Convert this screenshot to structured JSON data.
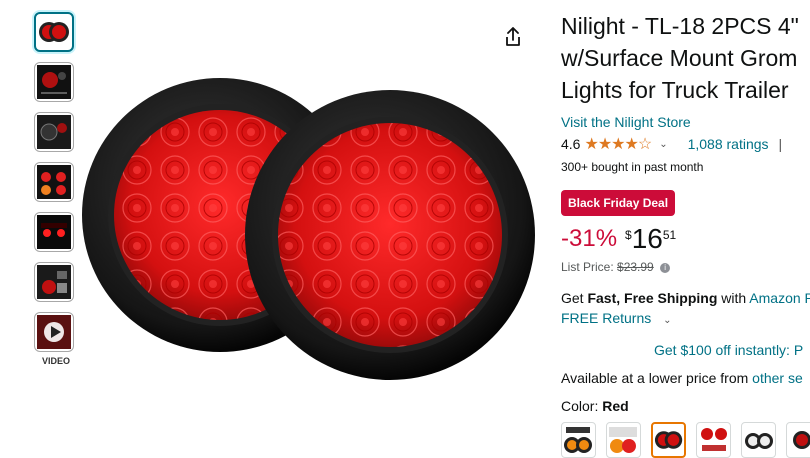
{
  "gallery": {
    "thumbnails": [
      {
        "name": "product-front-thumb",
        "active": true
      },
      {
        "name": "dimension-diagram-thumb",
        "active": false
      },
      {
        "name": "installation-thumb",
        "active": false
      },
      {
        "name": "light-modes-thumb",
        "active": false
      },
      {
        "name": "night-use-thumb",
        "active": false
      },
      {
        "name": "package-contents-thumb",
        "active": false
      }
    ],
    "video_label": "VIDEO"
  },
  "product": {
    "title_line1": "Nilight - TL-18 2PCS 4\"",
    "title_line2": "w/Surface Mount Grom",
    "title_line3": "Lights for Truck Trailer",
    "store_link": "Visit the Nilight Store",
    "rating": "4.6",
    "stars": "★★★★☆",
    "ratings_count": "1,088 ratings",
    "separator": "|",
    "bought": "300+ bought in past month",
    "deal_badge": "Black Friday Deal",
    "discount": "-31%",
    "currency": "$",
    "price_whole": "16",
    "price_fraction": "51",
    "list_price_label": "List Price:",
    "list_price": "$23.99",
    "shipping_get": "Get ",
    "shipping_bold": "Fast, Free Shipping",
    "shipping_with": " with ",
    "shipping_prime": "Amazon P",
    "free_returns": "FREE Returns",
    "promo": "Get $100 off instantly: P",
    "lower_price_text": "Available at a lower price from ",
    "lower_price_link": "other se",
    "color_label": "Color: ",
    "color_value": "Red"
  },
  "colors": {
    "accent_link": "#007185",
    "deal_red": "#cc0c39",
    "star_orange": "#de7921",
    "swatch_selected": "#e77600"
  }
}
